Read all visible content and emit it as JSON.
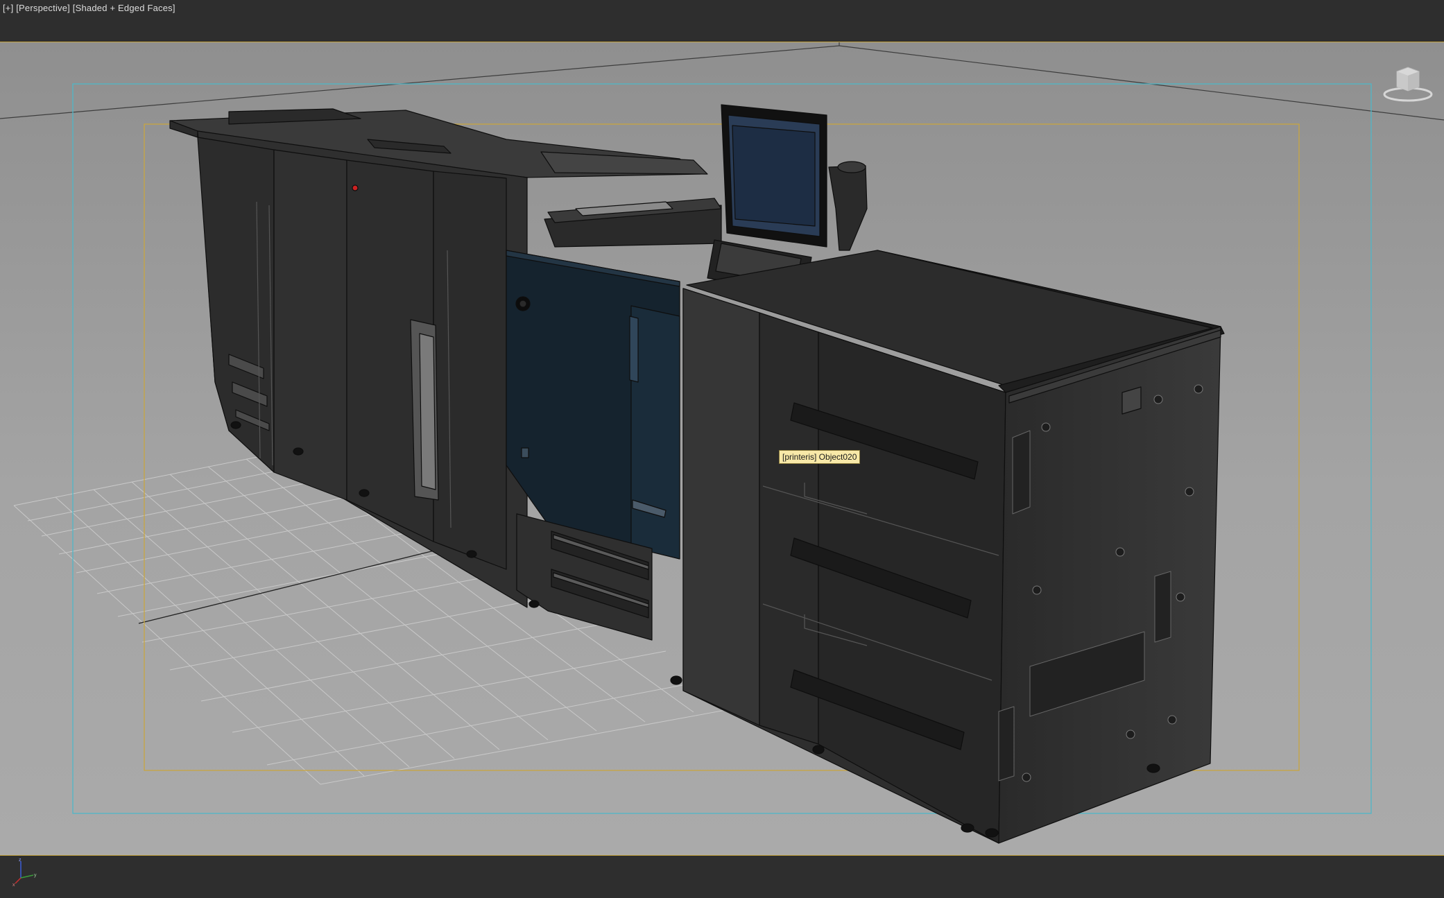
{
  "viewport": {
    "label_plus": "[+]",
    "label_view": "[Perspective]",
    "label_shading": "[Shaded + Edged Faces]",
    "tooltip": "[printeris] Object020",
    "viewcube_icon": "viewcube-icon",
    "axis_icon": "axis-tripod-icon",
    "axis_x": "x",
    "axis_y": "y",
    "axis_z": "z"
  },
  "colors": {
    "viewport_bg": "#9c9c9c",
    "safe_frame_outer": "#4fb7c8",
    "safe_frame_inner": "#c8a640",
    "tooltip_bg": "#f8e9a8",
    "ui_dark": "#2e2e2e"
  }
}
